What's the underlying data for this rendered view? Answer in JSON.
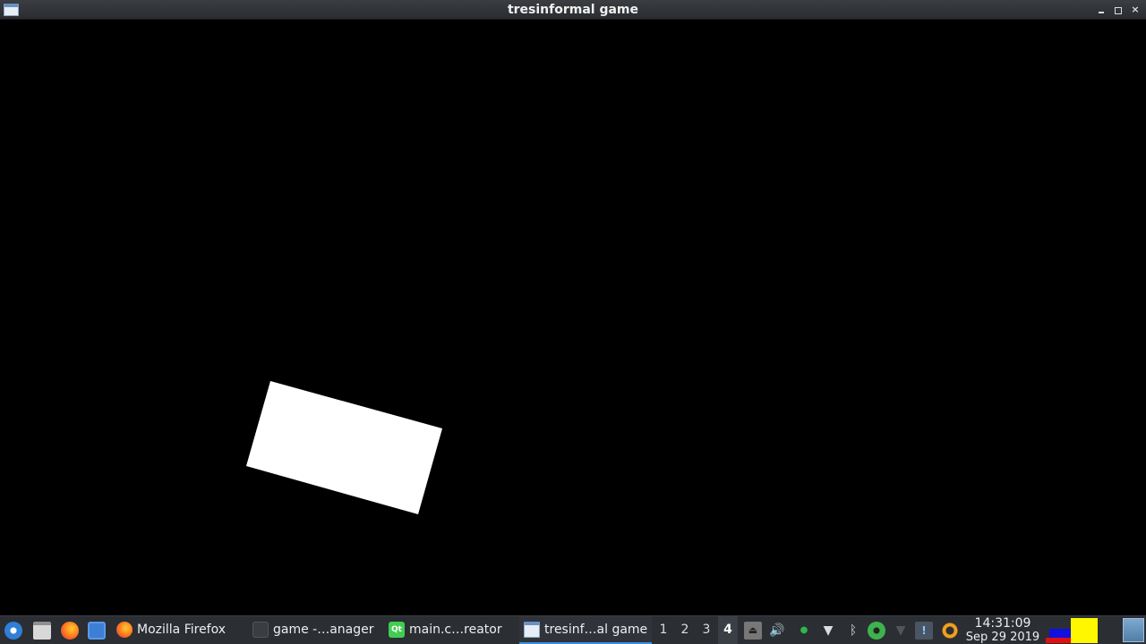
{
  "window": {
    "title": "tresinformal game"
  },
  "taskbar": {
    "tasks": [
      {
        "label": "Mozilla Firefox",
        "icon": "firefox-icon"
      },
      {
        "label": "game -…anager",
        "icon": "folder-icon"
      },
      {
        "label": "main.c…reator",
        "icon": "qt-creator-icon"
      },
      {
        "label": "tresinf…al game",
        "icon": "window-icon"
      }
    ],
    "qt_badge": "Qt",
    "workspaces": [
      "1",
      "2",
      "3",
      "4"
    ],
    "active_workspace": "4",
    "clock": {
      "time": "14:31:09",
      "date": "Sep 29 2019"
    }
  },
  "colors": {
    "background": "#000000",
    "shape": "#ffffff",
    "active_task_underline": "#3a8fe0"
  }
}
